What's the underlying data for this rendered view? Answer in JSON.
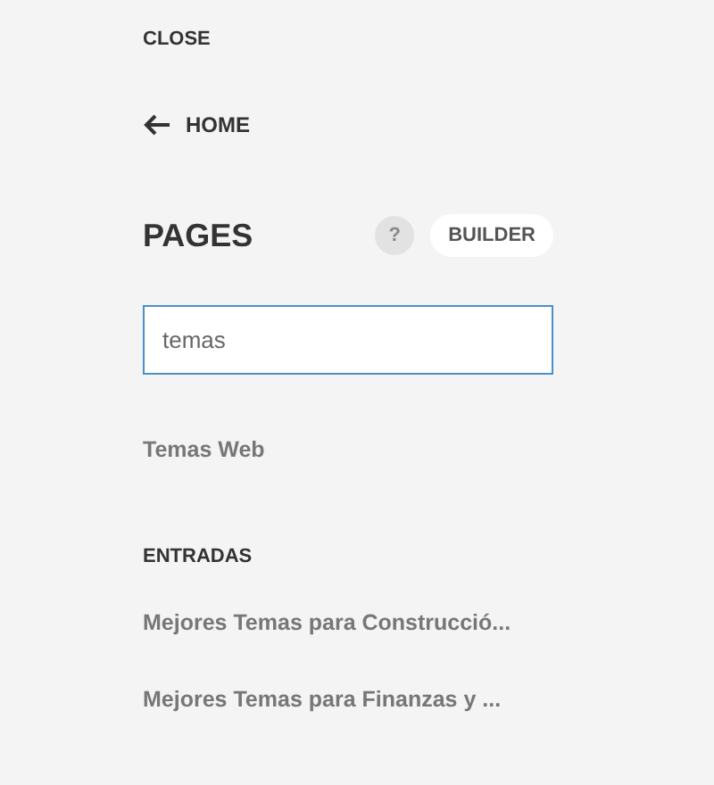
{
  "close_link": "CLOSE",
  "home_link": "HOME",
  "section_title": "PAGES",
  "help_button": "?",
  "builder_button": "BUILDER",
  "search": {
    "value": "temas",
    "focused": true
  },
  "page_results": [
    {
      "label": "Temas Web"
    }
  ],
  "entries_heading": "ENTRADAS",
  "entry_results": [
    {
      "label": "Mejores Temas para Construcció..."
    },
    {
      "label": "Mejores Temas para Finanzas y ..."
    }
  ]
}
